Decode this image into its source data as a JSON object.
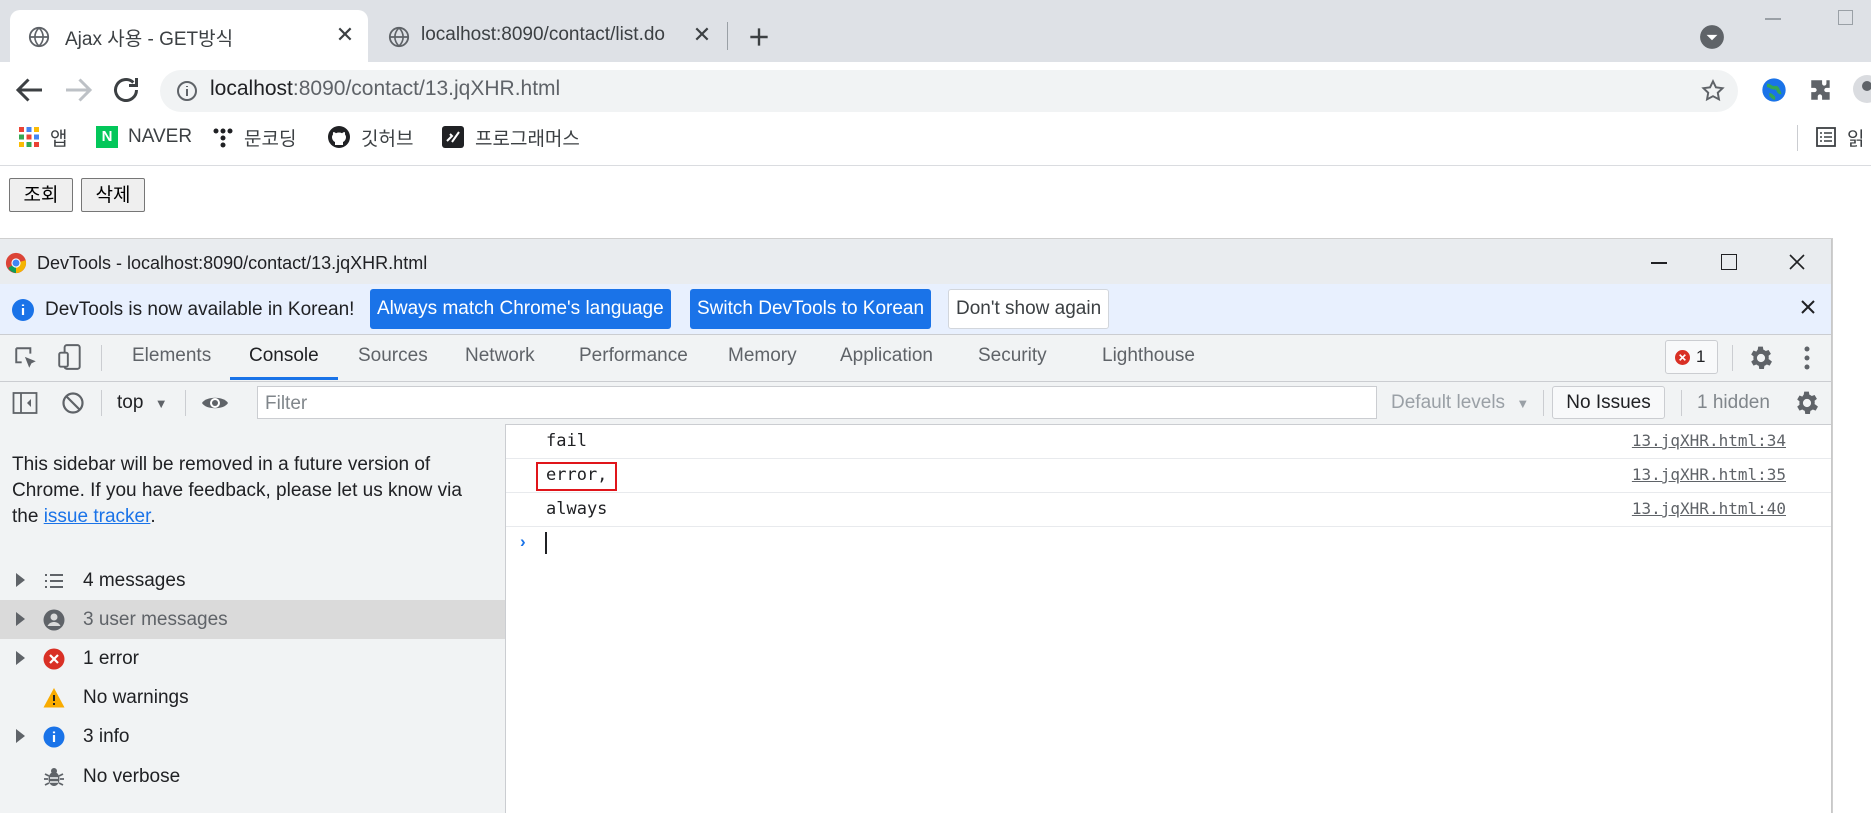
{
  "browser": {
    "tabs": [
      {
        "title": "Ajax 사용 - GET방식",
        "active": true
      },
      {
        "title": "localhost:8090/contact/list.do",
        "active": false
      }
    ],
    "new_tab_icon": "plus-icon",
    "url_host": "localhost",
    "url_path": ":8090/contact/13.jqXHR.html",
    "bookmarks": [
      {
        "label": "앱",
        "icon": "apps-grid-icon"
      },
      {
        "label": "NAVER",
        "icon": "naver-icon"
      },
      {
        "label": "문코딩",
        "icon": "dots-icon"
      },
      {
        "label": "깃허브",
        "icon": "github-icon"
      },
      {
        "label": "프로그래머스",
        "icon": "programmers-icon"
      }
    ],
    "reading_list_label": "읽"
  },
  "page": {
    "buttons": [
      {
        "label": "조회"
      },
      {
        "label": "삭제"
      }
    ]
  },
  "devtools": {
    "window_title": "DevTools - localhost:8090/contact/13.jqXHR.html",
    "infobar": {
      "message": "DevTools is now available in Korean!",
      "btn_match": "Always match Chrome's language",
      "btn_switch": "Switch DevTools to Korean",
      "btn_dismiss": "Don't show again"
    },
    "panel_tabs": [
      "Elements",
      "Console",
      "Sources",
      "Network",
      "Performance",
      "Memory",
      "Application",
      "Security",
      "Lighthouse"
    ],
    "active_panel": "Console",
    "error_count": "1",
    "console_bar": {
      "context": "top",
      "filter_placeholder": "Filter",
      "levels": "Default levels",
      "issues": "No Issues",
      "hidden": "1 hidden"
    },
    "sidebar": {
      "note_prefix": "This sidebar will be removed in a future version of Chrome. If you have feedback, please let us know via the ",
      "note_link": "issue tracker",
      "note_suffix": ".",
      "items": [
        {
          "label": "4 messages",
          "icon": "list-icon",
          "expandable": true
        },
        {
          "label": "3 user messages",
          "icon": "user-icon",
          "expandable": true,
          "selected": true
        },
        {
          "label": "1 error",
          "icon": "error-icon",
          "expandable": true
        },
        {
          "label": "No warnings",
          "icon": "warning-icon",
          "expandable": false
        },
        {
          "label": "3 info",
          "icon": "info-icon",
          "expandable": true
        },
        {
          "label": "No verbose",
          "icon": "bug-icon",
          "expandable": false
        }
      ]
    },
    "console_lines": [
      {
        "text": "fail",
        "source": "13.jqXHR.html:34"
      },
      {
        "text": "error,",
        "source": "13.jqXHR.html:35"
      },
      {
        "text": "always",
        "source": "13.jqXHR.html:40"
      }
    ]
  },
  "colors": {
    "accent": "#1a73e8",
    "error": "#d93025",
    "highlight_box": "#e0151a"
  }
}
